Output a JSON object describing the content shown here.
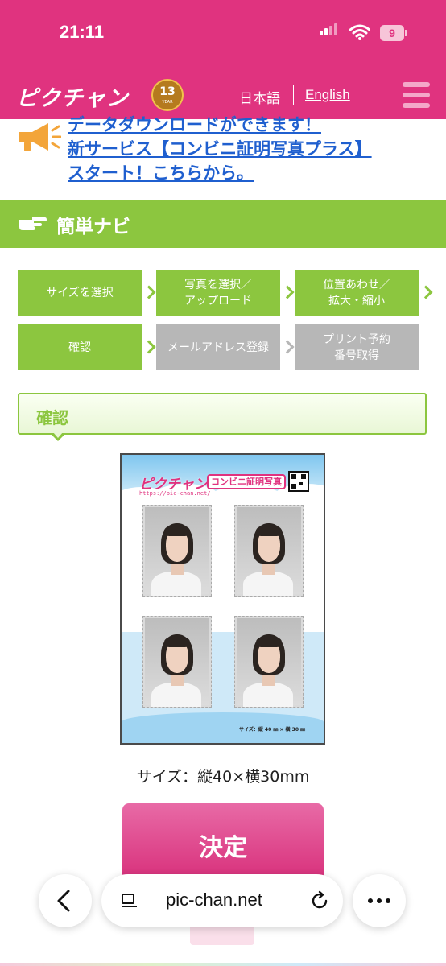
{
  "status_bar": {
    "time": "21:11",
    "battery": "9"
  },
  "header": {
    "logo": "ピクチャン",
    "badge_number": "13",
    "badge_text": "YEAR",
    "lang_ja": "日本語",
    "lang_en": "English"
  },
  "announcement": {
    "lines": [
      "データダウンロードができます！",
      "新サービス【コンビニ証明写真プラス】",
      "スタート！こちらから。"
    ]
  },
  "navi": {
    "title": "簡単ナビ",
    "steps": [
      {
        "label": "サイズを選択",
        "state": "active"
      },
      {
        "label": "写真を選択／\nアップロード",
        "state": "active"
      },
      {
        "label": "位置あわせ／\n拡大・縮小",
        "state": "active"
      },
      {
        "label": "確認",
        "state": "active"
      },
      {
        "label": "メールアドレス登録",
        "state": "inactive"
      },
      {
        "label": "プリント予約\n番号取得",
        "state": "inactive"
      }
    ]
  },
  "confirm": {
    "title": "確認"
  },
  "preview": {
    "logo": "ピクチャン",
    "title": "コンビニ証明写真",
    "url": "https://pic-chan.net/",
    "size_note": "サイズ：縦 40 ㎜ × 横 30 ㎜"
  },
  "size_text": "サイズ：縦40×横30mm",
  "decide_button": "決定",
  "browser": {
    "url": "pic-chan.net"
  },
  "colors": {
    "brand_pink": "#e0337f",
    "navi_green": "#8cc63f",
    "inactive_grey": "#b7b7b7"
  }
}
